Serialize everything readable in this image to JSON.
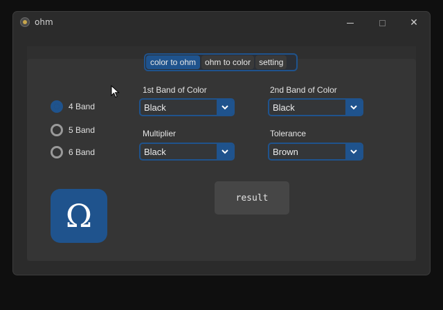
{
  "window": {
    "title": "ohm",
    "app_icon": "resistor-app-icon",
    "controls": {
      "minimize": "minimize-icon",
      "maximize": "maximize-icon",
      "close": "✕"
    }
  },
  "tabs": [
    {
      "label": "color to ohm",
      "active": true
    },
    {
      "label": "ohm to color",
      "active": false
    },
    {
      "label": "setting",
      "active": false
    }
  ],
  "band_options": [
    {
      "label": "4 Band",
      "selected": true
    },
    {
      "label": "5 Band",
      "selected": false
    },
    {
      "label": "6 Band",
      "selected": false
    }
  ],
  "fields": {
    "band1": {
      "label": "1st Band of Color",
      "value": "Black"
    },
    "band2": {
      "label": "2nd Band of Color",
      "value": "Black"
    },
    "multiplier": {
      "label": "Multiplier",
      "value": "Black"
    },
    "tolerance": {
      "label": "Tolerance",
      "value": "Brown"
    }
  },
  "logo": {
    "glyph": "Ω"
  },
  "result_button": {
    "label": "result"
  },
  "colors": {
    "accent": "#1f538d",
    "window_bg": "#2b2b2b",
    "panel_bg": "#353535",
    "button_bg": "#464646"
  }
}
